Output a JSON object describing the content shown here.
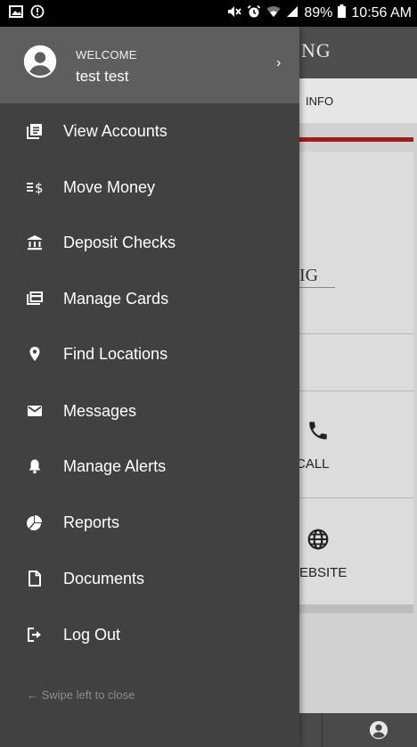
{
  "status_bar": {
    "battery": "89%",
    "time": "10:56 AM"
  },
  "background_app": {
    "header_text": "NG",
    "tab_label": "INFO",
    "logo_text": "IG",
    "call_label": "CALL",
    "website_label": "EBSITE"
  },
  "drawer": {
    "welcome_label": "WELCOME",
    "user_name": "test test",
    "chevron": "›",
    "items": [
      {
        "label": "View Accounts",
        "icon": "accounts-icon"
      },
      {
        "label": "Move Money",
        "icon": "move-money-icon"
      },
      {
        "label": "Deposit Checks",
        "icon": "bank-icon"
      },
      {
        "label": "Manage Cards",
        "icon": "cards-icon"
      },
      {
        "label": "Find Locations",
        "icon": "location-pin-icon"
      },
      {
        "label": "Messages",
        "icon": "envelope-icon"
      },
      {
        "label": "Manage Alerts",
        "icon": "bell-icon"
      },
      {
        "label": "Reports",
        "icon": "pie-chart-icon"
      },
      {
        "label": "Documents",
        "icon": "document-icon"
      },
      {
        "label": "Log Out",
        "icon": "logout-icon"
      }
    ],
    "swipe_hint": "←  Swipe left to close"
  }
}
